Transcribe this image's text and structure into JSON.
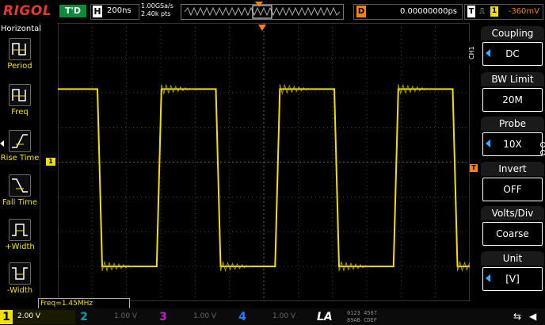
{
  "header": {
    "logo": "RIGOL",
    "trigger_status": "T'D",
    "horizontal_label": "H",
    "horizontal_scale": "200ns",
    "sample_rate": "1.00GSa/s",
    "memory_depth": "2.40k pts",
    "delay_label": "D",
    "delay_value": "0.00000000ps",
    "trigger_label": "T",
    "trigger_channel": "1",
    "trigger_level": "-360mV"
  },
  "left_menu": {
    "title": "Horizontal",
    "items": [
      {
        "label": "Period",
        "icon": "period-icon"
      },
      {
        "label": "Freq",
        "icon": "frequency-icon"
      },
      {
        "label": "Rise Time",
        "icon": "rise-time-icon"
      },
      {
        "label": "Fall Time",
        "icon": "fall-time-icon"
      },
      {
        "label": "+Width",
        "icon": "positive-width-icon"
      },
      {
        "label": "-Width",
        "icon": "negative-width-icon"
      }
    ]
  },
  "right_menu": {
    "channel_tab": "CH1",
    "items": [
      {
        "title": "Coupling",
        "value": "DC"
      },
      {
        "title": "BW Limit",
        "value": "20M"
      },
      {
        "title": "Probe",
        "value": "10X"
      },
      {
        "title": "Invert",
        "value": "OFF"
      },
      {
        "title": "Volts/Div",
        "value": "Coarse"
      },
      {
        "title": "Unit",
        "value": "[V]"
      }
    ]
  },
  "measurement": {
    "freq": "Freq=1.45MHz"
  },
  "channels": [
    {
      "num": "1",
      "scale": "2.00 V",
      "color": "#f0e000"
    },
    {
      "num": "2",
      "scale": "1.00 V",
      "color": "#00a0a0"
    },
    {
      "num": "3",
      "scale": "1.00 V",
      "color": "#c020c0"
    },
    {
      "num": "4",
      "scale": "1.00 V",
      "color": "#2080ff"
    }
  ],
  "bottom": {
    "la_label": "LA",
    "la_bits_top": "0123 4567",
    "la_bits_bottom": "89AB CDEF"
  },
  "markers": {
    "ch1": "1",
    "trigger": "T"
  },
  "colors": {
    "ch1": "#f0e000",
    "trigger": "#f08020",
    "brand": "#e8372c"
  },
  "trace": {
    "type": "square",
    "high_div": 2.1,
    "low_div": -3.0,
    "period_div": 3.45
  }
}
